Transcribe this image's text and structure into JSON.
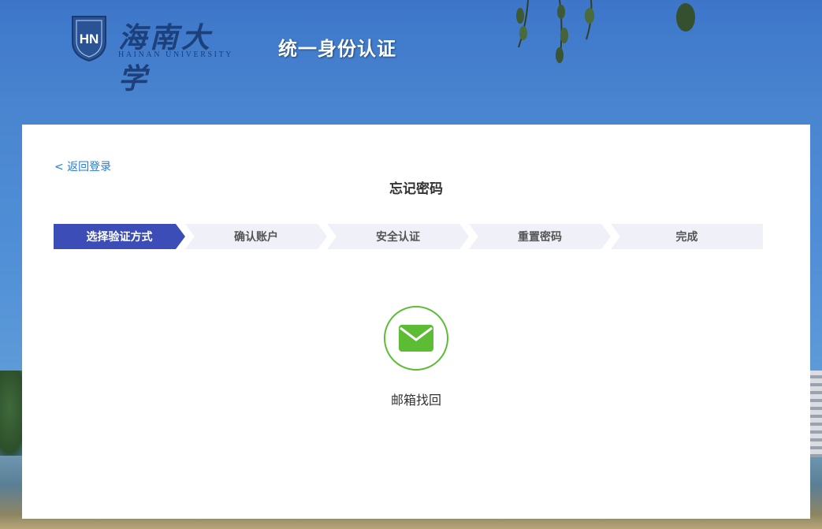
{
  "header": {
    "logo_cn": "海南大学",
    "logo_en": "HAINAN UNIVERSITY",
    "logo_badge_text": "HN",
    "system_title": "统一身份认证"
  },
  "colors": {
    "link": "#2b7bd6",
    "step_active_bg": "#3d4db7",
    "step_inactive_bg": "#eff0f8",
    "step_inactive_text": "#555555",
    "success_green": "#5cbc33"
  },
  "card": {
    "back_link": "< 返回登录",
    "title": "忘记密码",
    "steps": [
      {
        "label": "选择验证方式",
        "active": true
      },
      {
        "label": "确认账户",
        "active": false
      },
      {
        "label": "安全认证",
        "active": false
      },
      {
        "label": "重置密码",
        "active": false
      },
      {
        "label": "完成",
        "active": false
      }
    ],
    "options": [
      {
        "label": "邮箱找回",
        "icon": "envelope-icon"
      }
    ]
  }
}
